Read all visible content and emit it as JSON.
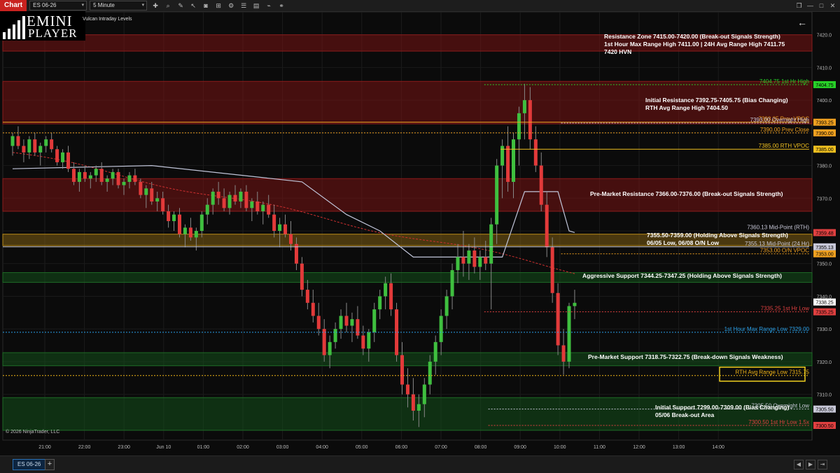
{
  "toolbar": {
    "chart_label": "Chart",
    "instrument": "ES 06-26",
    "interval": "5 Minute",
    "icons": [
      "crosshair-icon",
      "zoom-icon",
      "pencil-icon",
      "pointer-icon",
      "camera-icon",
      "indicators-icon",
      "strategies-icon",
      "list-icon",
      "properties-icon",
      "draw-icon",
      "link-icon"
    ]
  },
  "logo": {
    "line1": "EMINI",
    "line2": "PLAYER"
  },
  "indicator_label": "Vulcan Intraday Levels",
  "copyright": "© 2026 NinjaTrader, LLC",
  "tab_label": "ES 06-26",
  "colors": {
    "bull": "#3fbf3f",
    "bear": "#e23a3a",
    "resist_zone": "#5a1414",
    "support_zone": "#0f3a14",
    "hold_zone": "#5a4410",
    "orange": "#f0a020",
    "green_label": "#28d028",
    "red_label": "#e04040",
    "blue_label": "#2aa0e8",
    "gray_label": "#c8c8d8",
    "gold_label": "#f0b418"
  },
  "chart_data": {
    "type": "candlestick",
    "instrument": "ES 06-26",
    "interval": "5 Minute",
    "price_axis": {
      "ylim": [
        7296,
        7427
      ],
      "ticks": [
        7420.0,
        7410.0,
        7400.0,
        7390.0,
        7380.0,
        7370.0,
        7360.0,
        7350.0,
        7340.0,
        7330.0,
        7320.0,
        7310.0
      ]
    },
    "time_axis": {
      "ticks": [
        "21:00",
        "22:00",
        "23:00",
        "Jun 10",
        "01:00",
        "02:00",
        "03:00",
        "04:00",
        "05:00",
        "06:00",
        "07:00",
        "08:00",
        "09:00",
        "10:00",
        "11:00",
        "12:00",
        "13:00",
        "14:00"
      ]
    },
    "zones": [
      {
        "low": 7415.0,
        "high": 7420.0,
        "kind": "resist",
        "label": "Resistance Zone 7415.00-7420.00 (Break-out Signals Strength)\n1st Hour Max Range High 7411.00 | 24H Avg Range High 7411.75\n7420 HVN"
      },
      {
        "low": 7392.75,
        "high": 7405.75,
        "kind": "resist",
        "label": "Initial Resistance 7392.75-7405.75 (Bias Changing)\nRTH Avg Range High 7404.50"
      },
      {
        "low": 7366.0,
        "high": 7376.0,
        "kind": "resist",
        "label": "Pre-Market Resistance 7366.00-7376.00 (Break-out Signals Strength)"
      },
      {
        "low": 7355.5,
        "high": 7359.0,
        "kind": "hold",
        "label": "7355.50-7359.00 (Holding Above Signals Strength)\n06/05 Low, 06/08 O/N Low"
      },
      {
        "low": 7344.25,
        "high": 7347.25,
        "kind": "support",
        "label": "Aggressive Support 7344.25-7347.25 (Holding Above Signals Strength)"
      },
      {
        "low": 7318.75,
        "high": 7322.75,
        "kind": "support",
        "label": "Pre-Market Support 7318.75-7322.75 (Break-down Signals Weakness)"
      },
      {
        "low": 7299.0,
        "high": 7309.0,
        "kind": "support",
        "label": "Initial Support 7299.00-7309.00 (Bias Changing)\n05/06 Break-out Area"
      }
    ],
    "levels": [
      {
        "price": 7404.75,
        "label": "7404.75 1st Hr High",
        "color": "#28d028",
        "tag": "7404.75",
        "style": "dotted",
        "from": 0.595
      },
      {
        "price": 7393.25,
        "label": "7393.25 Prev VPOC",
        "color": "#f0a020",
        "tag": "7393.25",
        "style": "solid",
        "from": 0.0
      },
      {
        "price": 7393.0,
        "label": "7393.00 Overnight High",
        "color": "#c8c8d8",
        "tag": "",
        "style": "dotted",
        "from": 0.69
      },
      {
        "price": 7390.0,
        "label": "7390.00 Prev Close",
        "color": "#f0a020",
        "tag": "7390.00",
        "style": "dotted",
        "from": 0.0
      },
      {
        "price": 7385.0,
        "label": "7385.00 RTH VPOC",
        "color": "#f0c020",
        "tag": "7385.00",
        "style": "solid",
        "from": 0.615
      },
      {
        "price": 7360.13,
        "label": "7360.13 Mid-Point (RTH)",
        "color": "#c8c8d8",
        "tag": "",
        "style": "none",
        "from": 1
      },
      {
        "price": 7359.48,
        "label": "",
        "color": "#e04040",
        "tag": "7359.48",
        "style": "none",
        "from": 1
      },
      {
        "price": 7355.13,
        "label": "7355.13 Mid-Point (24 Hr)",
        "color": "#c8c8d8",
        "tag": "7355.13",
        "style": "solid",
        "from": 0.0
      },
      {
        "price": 7353.0,
        "label": "7353.00 O/N VPOC",
        "color": "#f0a020",
        "tag": "7353.00",
        "style": "dotted",
        "from": 0.69
      },
      {
        "price": 7335.25,
        "label": "7335.25 1st Hr Low",
        "color": "#e04040",
        "tag": "7335.25",
        "style": "dotted",
        "from": 0.595
      },
      {
        "price": 7329.0,
        "label": "1st Hour Max Range Low 7329.00",
        "color": "#2aa0e8",
        "tag": "",
        "style": "dotted",
        "from": 0.0
      },
      {
        "price": 7315.75,
        "label": "RTH Avg Range Low 7315.75",
        "color": "#f0b418",
        "tag": "",
        "style": "dotted",
        "from": 0.0,
        "boxed": true
      },
      {
        "price": 7305.5,
        "label": "7305.50 Overnight Low",
        "color": "#c8c8d8",
        "tag": "7305.50",
        "style": "dotted",
        "from": 0.6
      },
      {
        "price": 7300.5,
        "label": "7300.50 1st Hr Low 1.5x",
        "color": "#e04040",
        "tag": "7300.50",
        "style": "dotted",
        "from": 0.6
      }
    ],
    "last_price": {
      "price": 7338.25,
      "tag": "7338.25"
    },
    "candles": [
      [
        7386,
        7390,
        7383,
        7389
      ],
      [
        7389,
        7392,
        7385,
        7386
      ],
      [
        7386,
        7388,
        7381,
        7384
      ],
      [
        7384,
        7389,
        7382,
        7388
      ],
      [
        7388,
        7390,
        7383,
        7384
      ],
      [
        7384,
        7387,
        7380,
        7386
      ],
      [
        7386,
        7389,
        7384,
        7388
      ],
      [
        7388,
        7390,
        7384,
        7385
      ],
      [
        7385,
        7386,
        7380,
        7381
      ],
      [
        7381,
        7385,
        7379,
        7384
      ],
      [
        7384,
        7386,
        7378,
        7379
      ],
      [
        7379,
        7381,
        7374,
        7375
      ],
      [
        7375,
        7379,
        7372,
        7378
      ],
      [
        7378,
        7380,
        7375,
        7376
      ],
      [
        7376,
        7378,
        7373,
        7377
      ],
      [
        7377,
        7380,
        7375,
        7379
      ],
      [
        7379,
        7381,
        7374,
        7375
      ],
      [
        7375,
        7377,
        7372,
        7376
      ],
      [
        7376,
        7379,
        7374,
        7378
      ],
      [
        7378,
        7379,
        7373,
        7374
      ],
      [
        7374,
        7376,
        7371,
        7375
      ],
      [
        7375,
        7378,
        7373,
        7377
      ],
      [
        7377,
        7379,
        7374,
        7375
      ],
      [
        7375,
        7376,
        7370,
        7371
      ],
      [
        7371,
        7374,
        7367,
        7373
      ],
      [
        7373,
        7375,
        7368,
        7369
      ],
      [
        7369,
        7372,
        7366,
        7370
      ],
      [
        7370,
        7372,
        7365,
        7366
      ],
      [
        7366,
        7368,
        7361,
        7363
      ],
      [
        7363,
        7366,
        7360,
        7365
      ],
      [
        7365,
        7367,
        7358,
        7359
      ],
      [
        7359,
        7362,
        7355,
        7361
      ],
      [
        7361,
        7364,
        7357,
        7358
      ],
      [
        7358,
        7361,
        7354,
        7360
      ],
      [
        7360,
        7366,
        7358,
        7365
      ],
      [
        7365,
        7370,
        7362,
        7368
      ],
      [
        7368,
        7373,
        7365,
        7372
      ],
      [
        7372,
        7375,
        7368,
        7370
      ],
      [
        7370,
        7373,
        7366,
        7367
      ],
      [
        7367,
        7372,
        7365,
        7371
      ],
      [
        7371,
        7374,
        7368,
        7369
      ],
      [
        7369,
        7373,
        7367,
        7372
      ],
      [
        7372,
        7374,
        7366,
        7367
      ],
      [
        7367,
        7370,
        7363,
        7369
      ],
      [
        7369,
        7372,
        7365,
        7366
      ],
      [
        7366,
        7369,
        7362,
        7368
      ],
      [
        7368,
        7371,
        7364,
        7365
      ],
      [
        7365,
        7368,
        7358,
        7360
      ],
      [
        7360,
        7364,
        7355,
        7362
      ],
      [
        7362,
        7365,
        7358,
        7359
      ],
      [
        7359,
        7363,
        7354,
        7356
      ],
      [
        7356,
        7358,
        7348,
        7350
      ],
      [
        7350,
        7352,
        7340,
        7342
      ],
      [
        7342,
        7345,
        7336,
        7338
      ],
      [
        7338,
        7342,
        7332,
        7334
      ],
      [
        7334,
        7338,
        7328,
        7330
      ],
      [
        7330,
        7333,
        7320,
        7322
      ],
      [
        7322,
        7328,
        7318,
        7326
      ],
      [
        7326,
        7332,
        7324,
        7330
      ],
      [
        7330,
        7336,
        7327,
        7334
      ],
      [
        7334,
        7338,
        7329,
        7331
      ],
      [
        7331,
        7335,
        7326,
        7333
      ],
      [
        7333,
        7337,
        7327,
        7328
      ],
      [
        7328,
        7331,
        7322,
        7324
      ],
      [
        7324,
        7330,
        7320,
        7329
      ],
      [
        7329,
        7338,
        7326,
        7336
      ],
      [
        7336,
        7342,
        7333,
        7340
      ],
      [
        7340,
        7346,
        7336,
        7344
      ],
      [
        7344,
        7347,
        7334,
        7336
      ],
      [
        7336,
        7338,
        7320,
        7322
      ],
      [
        7322,
        7326,
        7310,
        7313
      ],
      [
        7313,
        7318,
        7306,
        7310
      ],
      [
        7310,
        7315,
        7302,
        7305
      ],
      [
        7305,
        7310,
        7300,
        7307
      ],
      [
        7307,
        7315,
        7303,
        7313
      ],
      [
        7313,
        7322,
        7310,
        7320
      ],
      [
        7320,
        7328,
        7316,
        7326
      ],
      [
        7326,
        7336,
        7322,
        7334
      ],
      [
        7334,
        7342,
        7330,
        7340
      ],
      [
        7340,
        7350,
        7336,
        7348
      ],
      [
        7348,
        7356,
        7344,
        7352
      ],
      [
        7352,
        7360,
        7346,
        7350
      ],
      [
        7350,
        7356,
        7345,
        7354
      ],
      [
        7354,
        7358,
        7347,
        7349
      ],
      [
        7349,
        7354,
        7345,
        7352
      ],
      [
        7352,
        7357,
        7348,
        7350
      ],
      [
        7350,
        7364,
        7336,
        7362
      ],
      [
        7362,
        7382,
        7356,
        7380
      ],
      [
        7380,
        7388,
        7370,
        7386
      ],
      [
        7386,
        7392,
        7372,
        7375
      ],
      [
        7375,
        7390,
        7370,
        7388
      ],
      [
        7388,
        7398,
        7380,
        7396
      ],
      [
        7396,
        7405,
        7388,
        7400
      ],
      [
        7400,
        7404,
        7385,
        7388
      ],
      [
        7388,
        7392,
        7378,
        7380
      ],
      [
        7380,
        7384,
        7366,
        7368
      ],
      [
        7368,
        7372,
        7352,
        7355
      ],
      [
        7355,
        7358,
        7338,
        7341
      ],
      [
        7341,
        7344,
        7322,
        7325
      ],
      [
        7325,
        7330,
        7316,
        7320
      ],
      [
        7320,
        7338,
        7318,
        7337
      ],
      [
        7337,
        7342,
        7333,
        7338
      ]
    ],
    "series": [
      {
        "name": "VWAP (RTH)",
        "color": "#d03030",
        "style": "dashed"
      },
      {
        "name": "24 Hr Mid",
        "color": "#c0c4d8",
        "style": "solid"
      }
    ]
  }
}
